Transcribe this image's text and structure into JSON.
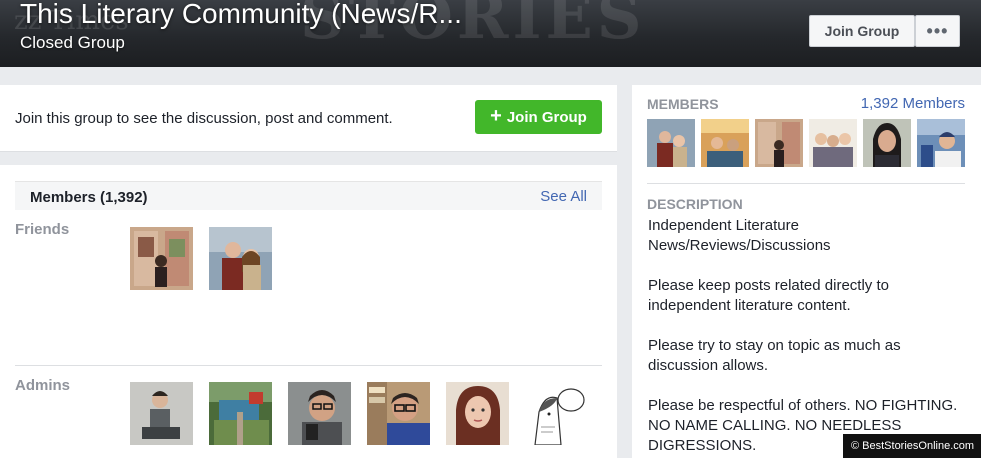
{
  "header": {
    "title": "This Literary Community (News/R...",
    "privacy": "Closed Group",
    "join_button": "Join Group",
    "more_button": "•••"
  },
  "join_prompt": {
    "text": "Join this group to see the discussion, post and comment.",
    "button_label": "Join Group"
  },
  "members_section": {
    "title": "Members (1,392)",
    "see_all": "See All",
    "friends_label": "Friends",
    "admins_label": "Admins"
  },
  "sidebar": {
    "members_label": "MEMBERS",
    "members_count": "1,392 Members",
    "description_label": "DESCRIPTION",
    "description": [
      "Independent Literature News/Reviews/Discussions",
      "Please keep posts related directly to independent literature content.",
      "Please try to stay on topic as much as discussion allows.",
      "Please be respectful of others. NO FIGHTING. NO NAME CALLING. NO NEEDLESS DIGRESSIONS."
    ]
  },
  "watermark": "© BestStoriesOnline.com",
  "colors": {
    "accent_blue": "#4267b2",
    "join_green": "#42b72a",
    "page_bg": "#e9ebee"
  }
}
